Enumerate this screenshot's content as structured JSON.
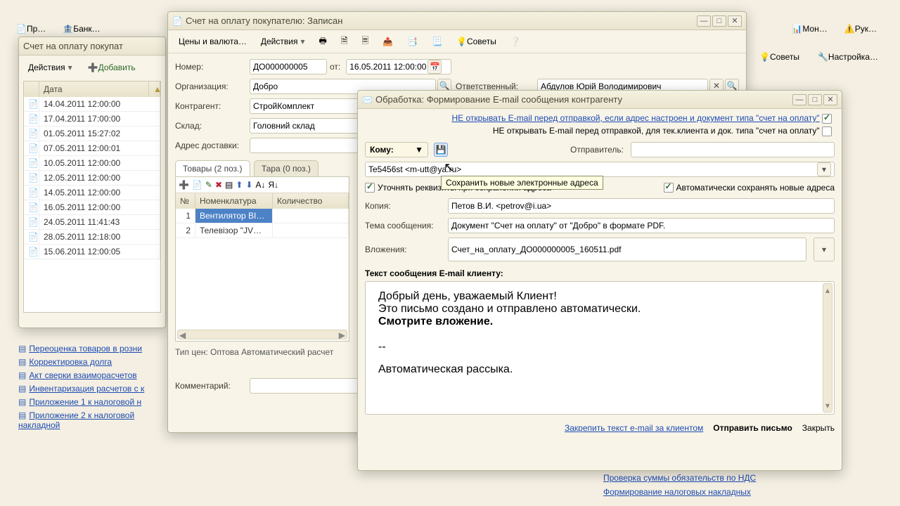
{
  "topbar": {
    "tabs": [
      "Пр…",
      "Банк…",
      "Мон…",
      "Рук…"
    ]
  },
  "leftWin": {
    "title": "Счет на оплату покупат",
    "actionsBtn": "Действия",
    "addBtn": "Добавить",
    "gridHeader": "Дата",
    "rows": [
      "14.04.2011 12:00:00",
      "17.04.2011 17:00:00",
      "01.05.2011 15:27:02",
      "07.05.2011 12:00:01",
      "10.05.2011 12:00:00",
      "12.05.2011 12:00:00",
      "14.05.2011 12:00:00",
      "16.05.2011 12:00:00",
      "24.05.2011 11:41:43",
      "28.05.2011 12:18:00",
      "15.06.2011 12:00:05"
    ],
    "links": [
      "Переоценка товаров в розни",
      "Корректировка долга",
      "Акт сверки взаиморасчетов",
      "Инвентаризация расчетов с к",
      "Приложение 1 к налоговой н",
      "Приложение 2 к налоговой накладной"
    ]
  },
  "docWin": {
    "title": "Счет на оплату покупателю: Записан",
    "pricesBtn": "Цены и валюта…",
    "actionsBtn": "Действия",
    "tipsBtn": "Советы",
    "numLbl": "Номер:",
    "numVal": "ДО000000005",
    "fromLbl": "от:",
    "dateVal": "16.05.2011 12:00:00",
    "orgLbl": "Организация:",
    "orgVal": "Добро",
    "respLbl": "Ответственный:",
    "respVal": "Абдулов Юрій Володимирович",
    "contrLbl": "Контрагент:",
    "contrVal": "СтройКомплект",
    "whLbl": "Склад:",
    "whVal": "Головний склад",
    "addrLbl": "Адрес доставки:",
    "tabs": {
      "goods": "Товары (2 поз.)",
      "tare": "Тара (0 поз.)"
    },
    "gridCols": {
      "num": "№",
      "nom": "Номенклатура",
      "qty": "Количество"
    },
    "rows": [
      {
        "n": "1",
        "name": "Вентилятор BI…"
      },
      {
        "n": "2",
        "name": "Телевізор \"JV…"
      }
    ],
    "priceNote": "Тип цен: Оптова Автоматический расчет",
    "commentLbl": "Комментарий:"
  },
  "emailWin": {
    "title": "Обработка:  Формирование E-mail сообщения контрагенту",
    "opt1": "НЕ открывать E-mail перед отправкой, если адрес настроен и документ типа \"счет на оплату\"",
    "opt2": "НЕ открывать E-mail перед отправкой, для тек.клиента и док. типа \"счет на оплату\"",
    "toLbl": "Кому:",
    "senderLbl": "Отправитель:",
    "addressValue": "Te5456st <m-utt@ya.ru>",
    "tooltip": "Сохранить новые электронные адреса",
    "refineLbl": "Уточнять реквизиты при сохранении адреса",
    "autoLbl": "Автоматически сохранять новые адреса",
    "copyLbl": "Копия:",
    "copyVal": "Петов В.И. <petrov@i.ua>",
    "subjLbl": "Тема сообщения:",
    "subjVal": "Документ \"Счет на оплату\" от \"Добро\" в формате PDF.",
    "attachLbl": "Вложения:",
    "attachVal": "Счет_на_оплату_ДО000000005_160511.pdf",
    "bodyLbl": "Текст сообщения E-mail клиенту:",
    "body_l1": "Добрый день, уважаемый Клиент!",
    "body_l2": "Это письмо создано и отправлено автоматически.",
    "body_l3": "Смотрите вложение.",
    "body_l4": "--",
    "body_l5": "Автоматическая рассыка.",
    "pinBtn": "Закрепить текст e-mail за клиентом",
    "sendBtn": "Отправить письмо",
    "closeBtn": "Закрыть"
  },
  "rightToolbar": {
    "tips": "Советы",
    "settings": "Настройка…"
  },
  "rightLinks": [
    "Проверка суммы обязательств по НДС",
    "Формирование налоговых накладных"
  ]
}
